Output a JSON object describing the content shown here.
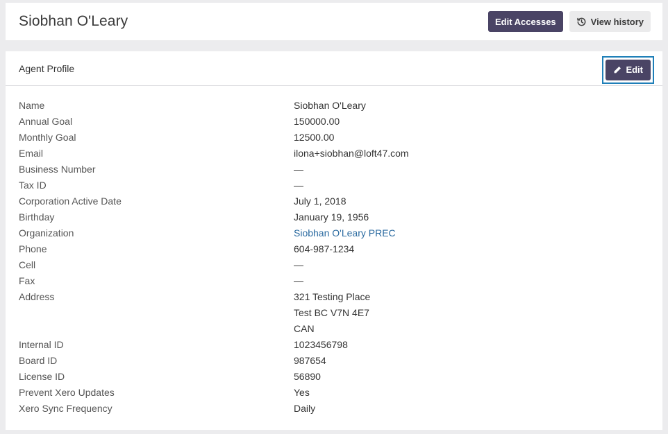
{
  "header": {
    "title": "Siobhan O'Leary",
    "edit_accesses_label": "Edit Accesses",
    "view_history_label": "View history",
    "history_icon": "history-icon"
  },
  "profile": {
    "title": "Agent Profile",
    "edit_label": "Edit",
    "edit_icon": "pencil-icon",
    "fields": {
      "name": {
        "label": "Name",
        "value": "Siobhan O'Leary"
      },
      "annual_goal": {
        "label": "Annual Goal",
        "value": "150000.00"
      },
      "monthly_goal": {
        "label": "Monthly Goal",
        "value": "12500.00"
      },
      "email": {
        "label": "Email",
        "value": "ilona+siobhan@loft47.com"
      },
      "business_number": {
        "label": "Business Number",
        "value": "—"
      },
      "tax_id": {
        "label": "Tax ID",
        "value": "—"
      },
      "corporation_active_date": {
        "label": "Corporation Active Date",
        "value": "July 1, 2018"
      },
      "birthday": {
        "label": "Birthday",
        "value": "January 19, 1956"
      },
      "organization": {
        "label": "Organization",
        "value": "Siobhan O'Leary PREC"
      },
      "phone": {
        "label": "Phone",
        "value": "604-987-1234"
      },
      "cell": {
        "label": "Cell",
        "value": "—"
      },
      "fax": {
        "label": "Fax",
        "value": "—"
      },
      "address": {
        "label": "Address",
        "line1": "321 Testing Place",
        "line2": "Test BC V7N 4E7",
        "line3": "CAN"
      },
      "internal_id": {
        "label": "Internal ID",
        "value": "1023456798"
      },
      "board_id": {
        "label": "Board ID",
        "value": "987654"
      },
      "license_id": {
        "label": "License ID",
        "value": "56890"
      },
      "prevent_xero_updates": {
        "label": "Prevent Xero Updates",
        "value": "Yes"
      },
      "xero_sync_frequency": {
        "label": "Xero Sync Frequency",
        "value": "Daily"
      }
    }
  },
  "colors": {
    "primary_button": "#4a4465",
    "secondary_button": "#ebebec",
    "link": "#2a6aa0",
    "focus_ring": "#1f7fb8",
    "page_background": "#ececee"
  }
}
